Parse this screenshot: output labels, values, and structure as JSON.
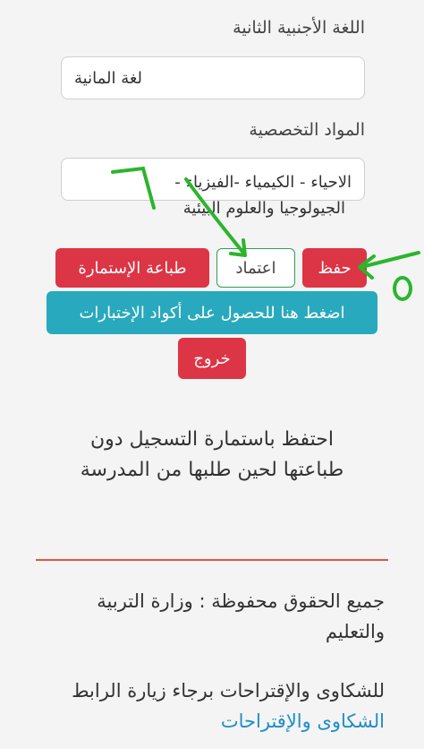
{
  "form": {
    "second_language": {
      "label": "اللغة الأجنبية الثانية",
      "value": "لغة المانية"
    },
    "specialization": {
      "label": "المواد التخصصية",
      "value_line1": "الاحياء - الكيمياء -الفيزياء -",
      "value_line2": "الجيولوجيا والعلوم البيئية"
    }
  },
  "buttons": {
    "save": "حفظ",
    "approve": "اعتماد",
    "print_form": "طباعة الإستمارة",
    "exam_codes": "اضغط هنا للحصول على أكواد الإختبارات",
    "exit": "خروج"
  },
  "note": {
    "line1": "احتفظ باستمارة التسجيل دون",
    "line2": "طباعتها لحين طلبها من المدرسة"
  },
  "footer": {
    "copyright_line1": "جميع الحقوق محفوظة : وزارة التربية",
    "copyright_line2": "والتعليم",
    "complaints_text": "للشكاوى والإقتراحات برجاء زيارة الرابط",
    "complaints_link": "الشكاوى والإقتراحات"
  },
  "annotations": {
    "mark_left": "٦",
    "mark_right": "٥",
    "color": "#2bb52b"
  },
  "colors": {
    "danger": "#dc3545",
    "info": "#29a9bd",
    "link": "#1e8fc7",
    "divider": "#e0553c"
  }
}
